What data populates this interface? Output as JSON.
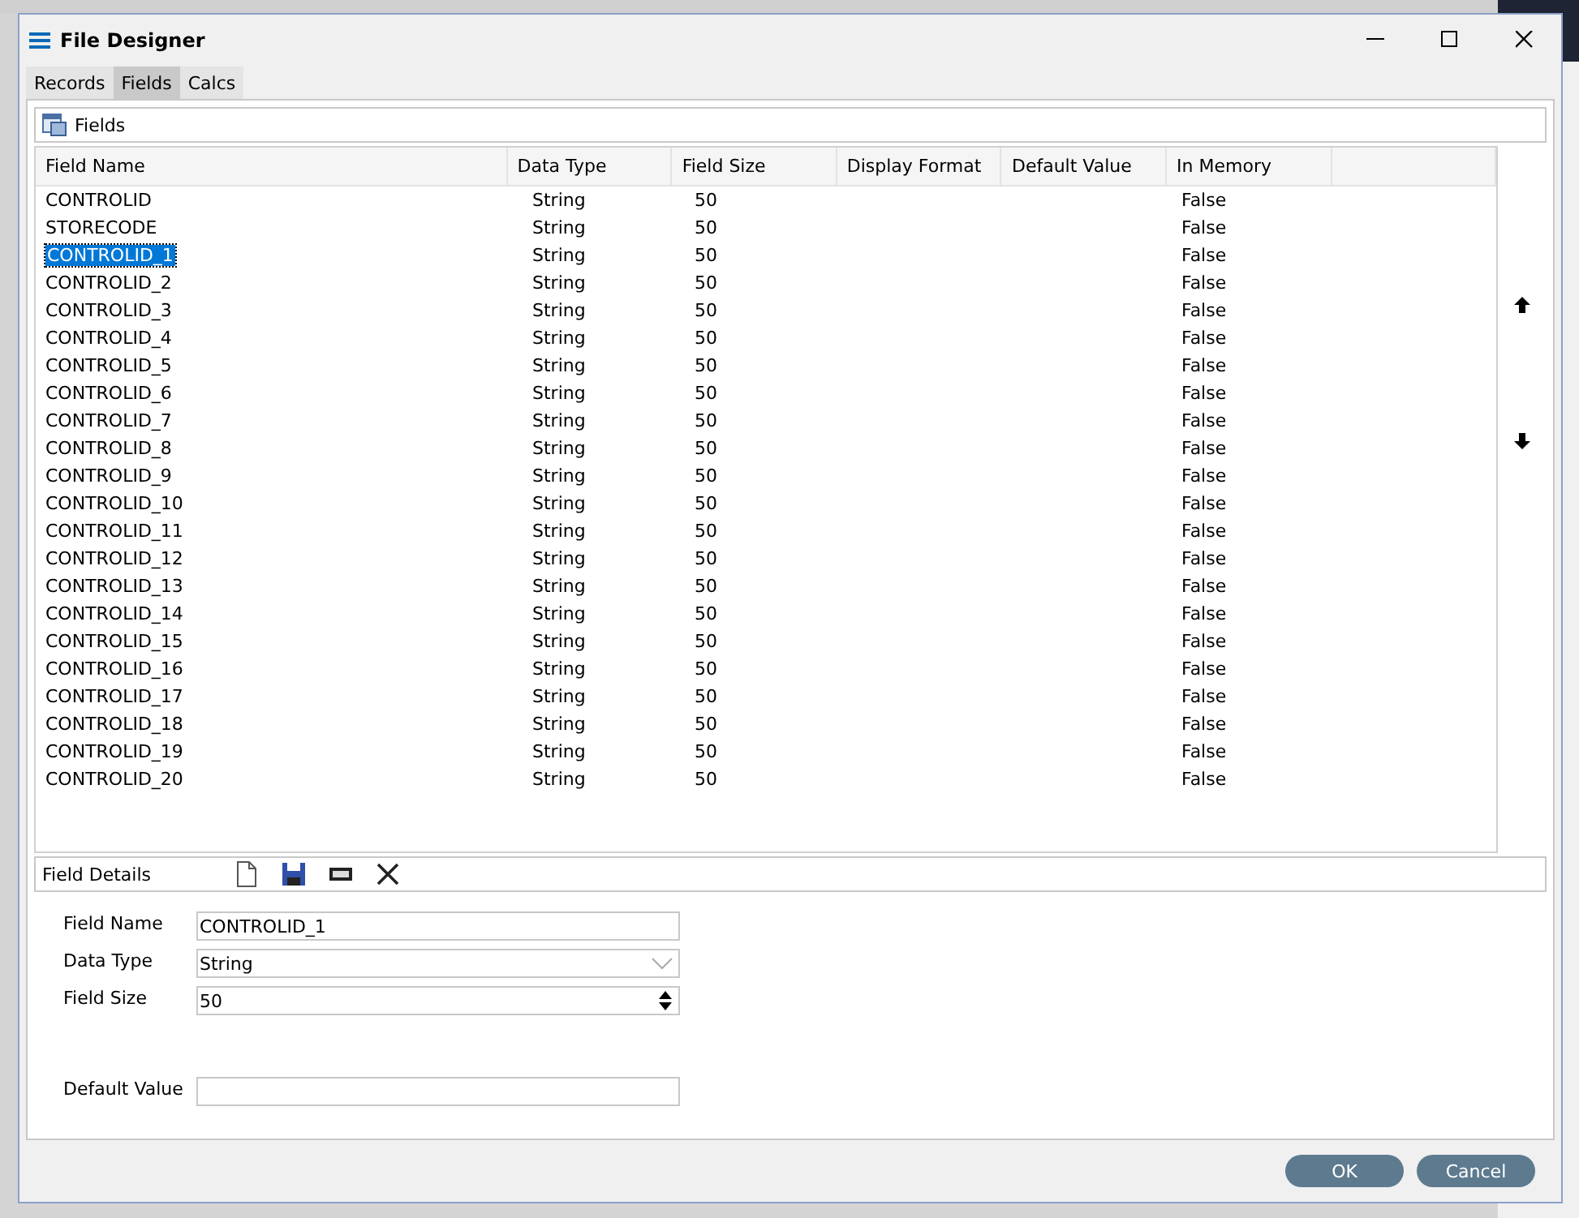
{
  "window": {
    "title": "File Designer"
  },
  "tabs": [
    {
      "label": "Records",
      "selected": false
    },
    {
      "label": "Fields",
      "selected": true
    },
    {
      "label": "Calcs",
      "selected": false
    }
  ],
  "fields_panel": {
    "title": "Fields"
  },
  "table": {
    "columns": [
      "Field Name",
      "Data Type",
      "Field Size",
      "Display Format",
      "Default Value",
      "In Memory"
    ],
    "rows": [
      {
        "cells": [
          "CONTROLID",
          "String",
          "50",
          "",
          "",
          "False"
        ],
        "selected": false
      },
      {
        "cells": [
          "STORECODE",
          "String",
          "50",
          "",
          "",
          "False"
        ],
        "selected": false
      },
      {
        "cells": [
          "CONTROLID_1",
          "String",
          "50",
          "",
          "",
          "False"
        ],
        "selected": true
      },
      {
        "cells": [
          "CONTROLID_2",
          "String",
          "50",
          "",
          "",
          "False"
        ],
        "selected": false
      },
      {
        "cells": [
          "CONTROLID_3",
          "String",
          "50",
          "",
          "",
          "False"
        ],
        "selected": false
      },
      {
        "cells": [
          "CONTROLID_4",
          "String",
          "50",
          "",
          "",
          "False"
        ],
        "selected": false
      },
      {
        "cells": [
          "CONTROLID_5",
          "String",
          "50",
          "",
          "",
          "False"
        ],
        "selected": false
      },
      {
        "cells": [
          "CONTROLID_6",
          "String",
          "50",
          "",
          "",
          "False"
        ],
        "selected": false
      },
      {
        "cells": [
          "CONTROLID_7",
          "String",
          "50",
          "",
          "",
          "False"
        ],
        "selected": false
      },
      {
        "cells": [
          "CONTROLID_8",
          "String",
          "50",
          "",
          "",
          "False"
        ],
        "selected": false
      },
      {
        "cells": [
          "CONTROLID_9",
          "String",
          "50",
          "",
          "",
          "False"
        ],
        "selected": false
      },
      {
        "cells": [
          "CONTROLID_10",
          "String",
          "50",
          "",
          "",
          "False"
        ],
        "selected": false
      },
      {
        "cells": [
          "CONTROLID_11",
          "String",
          "50",
          "",
          "",
          "False"
        ],
        "selected": false
      },
      {
        "cells": [
          "CONTROLID_12",
          "String",
          "50",
          "",
          "",
          "False"
        ],
        "selected": false
      },
      {
        "cells": [
          "CONTROLID_13",
          "String",
          "50",
          "",
          "",
          "False"
        ],
        "selected": false
      },
      {
        "cells": [
          "CONTROLID_14",
          "String",
          "50",
          "",
          "",
          "False"
        ],
        "selected": false
      },
      {
        "cells": [
          "CONTROLID_15",
          "String",
          "50",
          "",
          "",
          "False"
        ],
        "selected": false
      },
      {
        "cells": [
          "CONTROLID_16",
          "String",
          "50",
          "",
          "",
          "False"
        ],
        "selected": false
      },
      {
        "cells": [
          "CONTROLID_17",
          "String",
          "50",
          "",
          "",
          "False"
        ],
        "selected": false
      },
      {
        "cells": [
          "CONTROLID_18",
          "String",
          "50",
          "",
          "",
          "False"
        ],
        "selected": false
      },
      {
        "cells": [
          "CONTROLID_19",
          "String",
          "50",
          "",
          "",
          "False"
        ],
        "selected": false
      },
      {
        "cells": [
          "CONTROLID_20",
          "String",
          "50",
          "",
          "",
          "False"
        ],
        "selected": false
      }
    ]
  },
  "details": {
    "title": "Field Details",
    "fields": [
      {
        "label": "Field Name",
        "kind": "text",
        "value": "CONTROLID_1"
      },
      {
        "label": "Data Type",
        "kind": "dropdown",
        "value": "String"
      },
      {
        "label": "Field Size",
        "kind": "spinner",
        "value": "50"
      },
      {
        "label": "Default Value",
        "kind": "text"
      }
    ]
  },
  "buttons": [
    "OK",
    "Cancel"
  ]
}
